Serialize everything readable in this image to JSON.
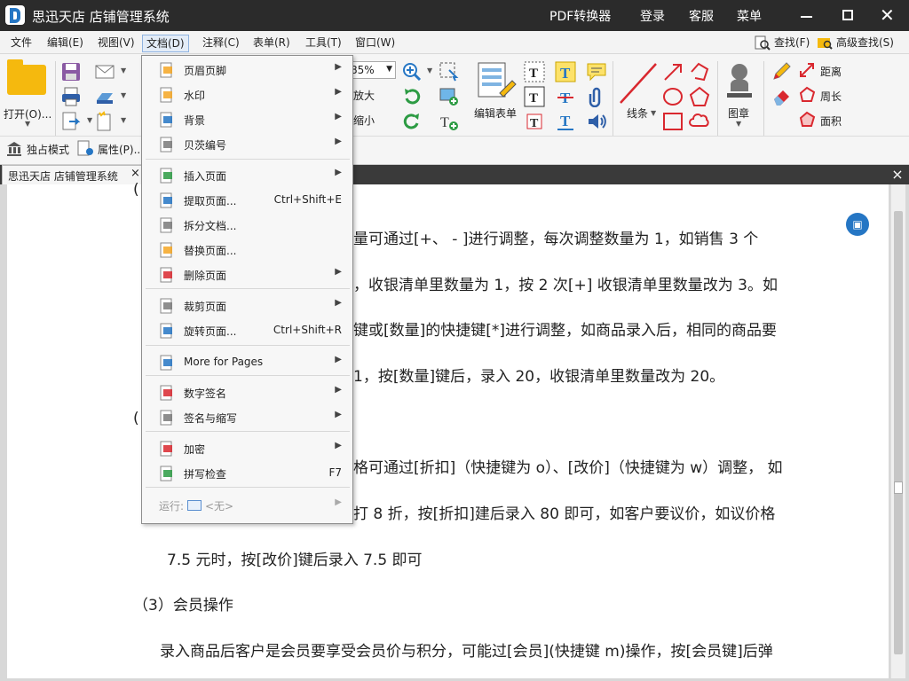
{
  "titlebar": {
    "app_title": "思迅天店 店铺管理系统",
    "pdf_converter": "PDF转换器",
    "login": "登录",
    "service": "客服",
    "menu": "菜单"
  },
  "menubar": {
    "items": [
      "文件",
      "编辑(E)",
      "视图(V)",
      "文档(D)",
      "注释(C)",
      "表单(R)",
      "工具(T)",
      "窗口(W)"
    ],
    "find": "查找(F)",
    "advanced_find": "高级查找(S)"
  },
  "toolbar": {
    "open": "打开(O)...",
    "zoom_value": "85%",
    "zoom_in": "放大",
    "zoom_out": "缩小",
    "edit_form": "编辑表单",
    "lines": "线条",
    "stamp": "图章",
    "distance": "距离",
    "perimeter": "周长",
    "area": "面积",
    "single_mode": "独占模式",
    "properties": "属性(P)..."
  },
  "tabbar": {
    "tab_label": "思迅天店 店铺管理系统",
    "tab_close": "×",
    "doc_close": "×"
  },
  "document": {
    "lines": [
      "(",
      "量可通过[+、 - ]进行调整，每次调整数量为 1，如销售 3 个",
      "，收银清单里数量为 1，按 2 次[+]  收银清单里数量改为 3。如",
      "键或[数量]的快捷键[*]进行调整，如商品录入后，相同的商品要",
      "1，按[数量]键后，录入 20，收银清单里数量改为 20。",
      "(",
      "格可通过[折扣]（快捷键为 o）、[改价]（快捷键为 w）调整，  如",
      "打 8 折，按[折扣]建后录入 80 即可，如客户要议价，如议价格",
      "7.5 元时，按[改价]键后录入 7.5 即可",
      "（3）会员操作",
      "录入商品后客户是会员要享受会员价与积分，可能过[会员](快捷键 m)操作，按[会员键]后弹"
    ]
  },
  "dropdown": {
    "items": [
      {
        "label": "页眉页脚",
        "shortcut": "",
        "submenu": true
      },
      {
        "label": "水印",
        "shortcut": "",
        "submenu": true
      },
      {
        "label": "背景",
        "shortcut": "",
        "submenu": true
      },
      {
        "label": "贝茨编号",
        "shortcut": "",
        "submenu": true
      },
      {
        "label": "插入页面",
        "shortcut": "",
        "submenu": true
      },
      {
        "label": "提取页面...",
        "shortcut": "Ctrl+Shift+E",
        "submenu": false
      },
      {
        "label": "拆分文档...",
        "shortcut": "",
        "submenu": false
      },
      {
        "label": "替换页面...",
        "shortcut": "",
        "submenu": false
      },
      {
        "label": "删除页面",
        "shortcut": "",
        "submenu": true
      },
      {
        "label": "裁剪页面",
        "shortcut": "",
        "submenu": true
      },
      {
        "label": "旋转页面...",
        "shortcut": "Ctrl+Shift+R",
        "submenu": false
      },
      {
        "label": "More for Pages",
        "shortcut": "",
        "submenu": true
      },
      {
        "label": "数字签名",
        "shortcut": "",
        "submenu": true
      },
      {
        "label": "签名与缩写",
        "shortcut": "",
        "submenu": true
      },
      {
        "label": "加密",
        "shortcut": "",
        "submenu": true
      },
      {
        "label": "拼写检查",
        "shortcut": "F7",
        "submenu": false
      }
    ],
    "run_label": "运行:",
    "run_value": "<无>"
  },
  "colors": {
    "accent": "#2576c4",
    "title_bg": "#2b2b2b",
    "red_tool": "#d9282f"
  }
}
